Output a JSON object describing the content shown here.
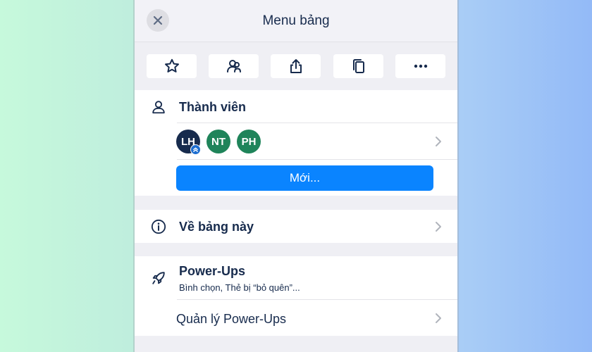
{
  "header": {
    "title": "Menu bảng"
  },
  "actions": [
    {
      "icon": "star-icon"
    },
    {
      "icon": "members-icon"
    },
    {
      "icon": "share-icon"
    },
    {
      "icon": "copy-icon"
    },
    {
      "icon": "more-icon"
    }
  ],
  "members": {
    "title": "Thành viên",
    "avatars": [
      {
        "initials": "LH",
        "color": "#172b4d"
      },
      {
        "initials": "NT",
        "color": "#1f845a"
      },
      {
        "initials": "PH",
        "color": "#1f845a"
      }
    ],
    "new_button": "Mới..."
  },
  "about": {
    "title": "Về bảng này"
  },
  "powerups": {
    "title": "Power-Ups",
    "subtitle": "Bình chọn, Thẻ bị “bỏ quên”...",
    "manage_label": "Quản lý Power-Ups"
  },
  "colors": {
    "accent": "#0a84ff",
    "text": "#172b4d",
    "background": "#efeff4"
  }
}
